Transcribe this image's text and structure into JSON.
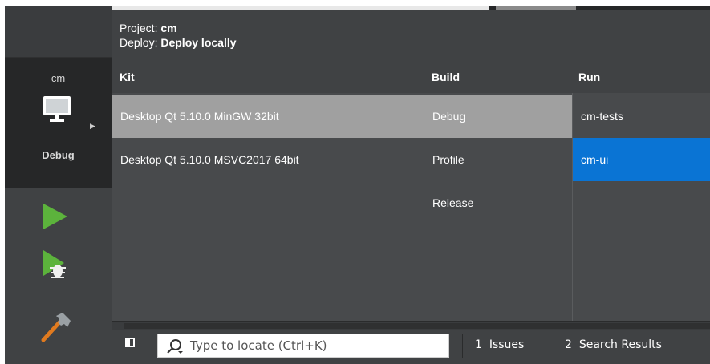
{
  "colors": {
    "background": "#404244",
    "dark_panel": "#262728",
    "selected_gray": "#a0a0a0",
    "selected_blue": "#0a74d4",
    "run_green": "#5cb33c"
  },
  "mode_bar": {
    "target": {
      "project": "cm",
      "icon": "monitor-icon",
      "build": "Debug"
    },
    "buttons": [
      {
        "name": "run",
        "icon": "run-icon"
      },
      {
        "name": "debug",
        "icon": "debug-run-icon"
      },
      {
        "name": "build",
        "icon": "hammer-icon"
      }
    ]
  },
  "popup": {
    "project_label": "Project:",
    "project_value": "cm",
    "deploy_label": "Deploy:",
    "deploy_value": "Deploy locally",
    "columns": {
      "kit": {
        "header": "Kit",
        "items": [
          "Desktop Qt 5.10.0 MinGW 32bit",
          "Desktop Qt 5.10.0 MSVC2017 64bit"
        ],
        "selected": 0
      },
      "build": {
        "header": "Build",
        "items": [
          "Debug",
          "Profile",
          "Release"
        ],
        "selected": 0
      },
      "run": {
        "header": "Run",
        "items": [
          "cm-tests",
          "cm-ui"
        ],
        "selected": 1
      }
    }
  },
  "status_bar": {
    "locator_placeholder": "Type to locate (Ctrl+K)",
    "tabs": [
      {
        "number": "1",
        "label": "Issues"
      },
      {
        "number": "2",
        "label": "Search Results"
      }
    ]
  }
}
